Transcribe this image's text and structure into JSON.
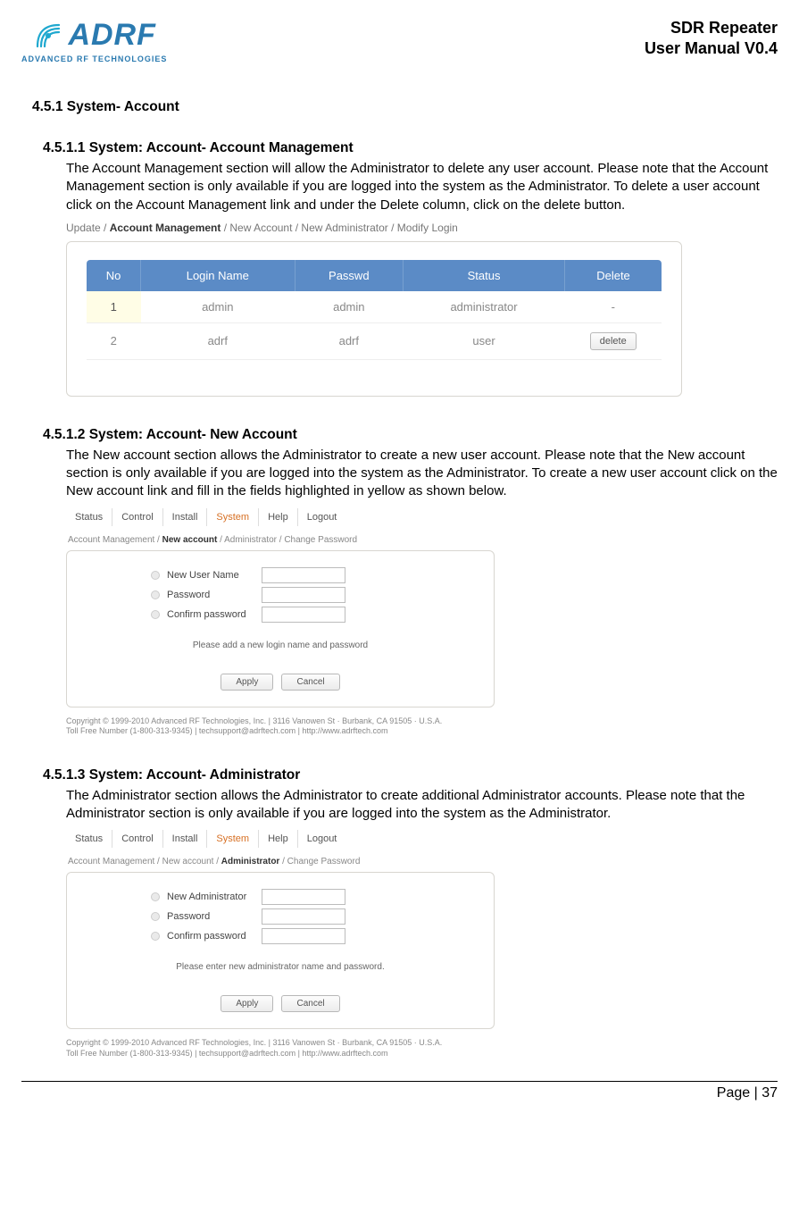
{
  "header": {
    "logo_text": "ADRF",
    "logo_sub": "ADVANCED RF TECHNOLOGIES",
    "title_line1": "SDR Repeater",
    "title_line2": "User Manual V0.4"
  },
  "sec451": "4.5.1 System- Account",
  "sec4511": {
    "heading": "4.5.1.1 System: Account- Account Management",
    "body": "The Account Management section will allow the Administrator to delete any user account.   Please note that the Account Management section is only available if you are logged into the system as the Administrator.   To delete a user account click on the Account Management link and under the Delete column, click on the delete button.",
    "crumb": {
      "a": "Update / ",
      "b": "Account Management",
      "c": " / New Account / New Administrator / Modify Login"
    },
    "table": {
      "headers": [
        "No",
        "Login Name",
        "Passwd",
        "Status",
        "Delete"
      ],
      "rows": [
        {
          "no": "1",
          "login": "admin",
          "passwd": "admin",
          "status": "administrator",
          "delete": "-"
        },
        {
          "no": "2",
          "login": "adrf",
          "passwd": "adrf",
          "status": "user",
          "delete_btn": "delete"
        }
      ]
    }
  },
  "sec4512": {
    "heading": "4.5.1.2 System: Account- New Account",
    "body": "The New account section allows the Administrator to create a new user account.   Please note that the New account section is only available if you are logged into the system as the Administrator.   To create a new user account click on the New account link and fill in the fields highlighted in yellow as shown below.",
    "tabs": [
      "Status",
      "Control",
      "Install",
      "System",
      "Help",
      "Logout"
    ],
    "crumb": {
      "a": "Account Management / ",
      "b": "New account",
      "c": " / Administrator / Change Password"
    },
    "fields": [
      "New User Name",
      "Password",
      "Confirm password"
    ],
    "msg": "Please add a new login name and password",
    "apply": "Apply",
    "cancel": "Cancel",
    "copyright1": "Copyright © 1999-2010 Advanced RF Technologies, Inc. | 3116 Vanowen St · Burbank, CA 91505 · U.S.A.",
    "copyright2": "Toll Free Number (1-800-313-9345) | techsupport@adrftech.com | http://www.adrftech.com"
  },
  "sec4513": {
    "heading": "4.5.1.3 System: Account- Administrator",
    "body": "The Administrator section allows the Administrator to create additional Administrator accounts.   Please note that the Administrator section is only available if you are logged into the system as the Administrator.",
    "tabs": [
      "Status",
      "Control",
      "Install",
      "System",
      "Help",
      "Logout"
    ],
    "crumb": {
      "a": "Account Management / New account / ",
      "b": "Administrator",
      "c": " / Change Password"
    },
    "fields": [
      "New Administrator",
      "Password",
      "Confirm password"
    ],
    "msg": "Please enter new administrator name and password.",
    "apply": "Apply",
    "cancel": "Cancel",
    "copyright1": "Copyright © 1999-2010 Advanced RF Technologies, Inc. | 3116 Vanowen St · Burbank, CA 91505 · U.S.A.",
    "copyright2": "Toll Free Number (1-800-313-9345) | techsupport@adrftech.com | http://www.adrftech.com"
  },
  "footer": {
    "page": "Page | 37"
  }
}
